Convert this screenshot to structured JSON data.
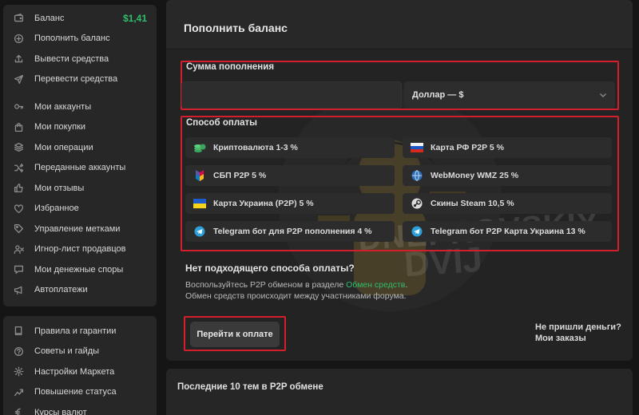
{
  "sidebar": {
    "balance_value": "$1,41",
    "items": [
      {
        "label": "Баланс",
        "icon": "wallet-icon"
      },
      {
        "label": "Пополнить баланс",
        "icon": "plus-circle-icon"
      },
      {
        "label": "Вывести средства",
        "icon": "upload-icon"
      },
      {
        "label": "Перевести средства",
        "icon": "send-icon"
      },
      {
        "label": "Мои аккаунты",
        "icon": "key-icon"
      },
      {
        "label": "Мои покупки",
        "icon": "shopping-bag-icon"
      },
      {
        "label": "Мои операции",
        "icon": "stack-icon"
      },
      {
        "label": "Переданные аккаунты",
        "icon": "shuffle-icon"
      },
      {
        "label": "Мои отзывы",
        "icon": "thumbs-up-icon"
      },
      {
        "label": "Избранное",
        "icon": "heart-icon"
      },
      {
        "label": "Управление метками",
        "icon": "tag-icon"
      },
      {
        "label": "Игнор-лист продавцов",
        "icon": "user-block-icon"
      },
      {
        "label": "Мои денежные споры",
        "icon": "chat-icon"
      },
      {
        "label": "Автоплатежи",
        "icon": "megaphone-icon"
      }
    ],
    "bottom_items": [
      {
        "label": "Правила и гарантии",
        "icon": "book-icon"
      },
      {
        "label": "Советы и гайды",
        "icon": "question-icon"
      },
      {
        "label": "Настройки Маркета",
        "icon": "gear-icon"
      },
      {
        "label": "Повышение статуса",
        "icon": "trend-up-icon"
      },
      {
        "label": "Курсы валют",
        "icon": "currency-icon"
      }
    ]
  },
  "main": {
    "title": "Пополнить баланс",
    "amount_label": "Сумма пополнения",
    "amount_value": "",
    "amount_placeholder": "",
    "currency_selected": "Доллар — $",
    "methods_label": "Способ оплаты",
    "methods": [
      {
        "label": "Криптовалюта 1-3 %",
        "icon": "crypto-coins-icon"
      },
      {
        "label": "Карта РФ P2P 5 %",
        "icon": "russia-flag-icon"
      },
      {
        "label": "СБП P2P 5 %",
        "icon": "sbp-logo-icon"
      },
      {
        "label": "WebMoney WMZ 25 %",
        "icon": "webmoney-globe-icon"
      },
      {
        "label": "Карта Украина (P2P) 5 %",
        "icon": "ukraine-flag-icon"
      },
      {
        "label": "Скины Steam 10,5 %",
        "icon": "steam-logo-icon"
      },
      {
        "label": "Telegram бот для P2P пополнения 4 %",
        "icon": "telegram-icon"
      },
      {
        "label": "Telegram бот P2P Карта Украина 13 %",
        "icon": "telegram-icon"
      }
    ],
    "no_method_title": "Нет подходящего способа оплаты?",
    "hint_line1_prefix": "Воспользуйтесь P2P обменом в разделе ",
    "hint_link": "Обмен средств",
    "hint_line1_suffix": ".",
    "hint_line2": "Обмен средств происходит между участниками форума.",
    "pay_button": "Перейти к оплате",
    "no_money_link": "Не пришли деньги?",
    "my_orders_link": "Мои заказы",
    "watermark_text1": "DNEPROVSKIY",
    "watermark_text2": "DVIJ"
  },
  "recent": {
    "title": "Последние 10 тем в P2P обмене"
  },
  "colors": {
    "accent_green": "#2fbe6b",
    "highlight_red": "#d31f2c",
    "panel": "#272727",
    "background": "#151515"
  }
}
